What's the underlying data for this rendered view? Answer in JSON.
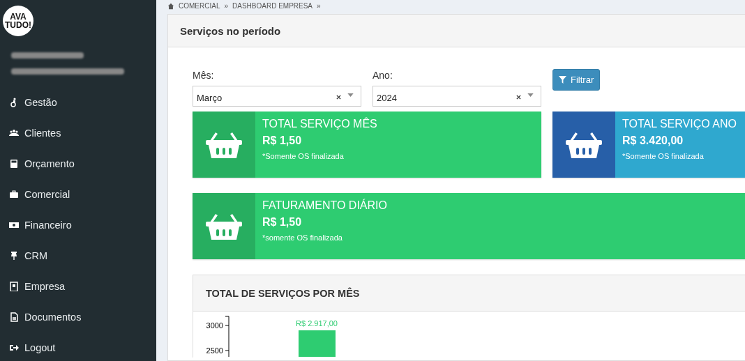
{
  "sidebar": {
    "logo": [
      "AVA",
      "TUDO!"
    ],
    "items": [
      {
        "label": "Gestão"
      },
      {
        "label": "Clientes"
      },
      {
        "label": "Orçamento"
      },
      {
        "label": "Comercial"
      },
      {
        "label": "Financeiro"
      },
      {
        "label": "CRM"
      },
      {
        "label": "Empresa"
      },
      {
        "label": "Documentos"
      },
      {
        "label": "Logout"
      }
    ]
  },
  "breadcrumb": [
    "COMERCIAL",
    "»",
    "DASHBOARD EMPRESA",
    "»"
  ],
  "panel": {
    "title": "Serviços no período",
    "filters": [
      {
        "label": "Mês:",
        "value": "Março"
      },
      {
        "label": "Ano:",
        "value": "2024"
      }
    ],
    "filter_button": "Filtrar",
    "cards": [
      {
        "title": "TOTAL SERVIÇO MÊS",
        "value": "R$ 1,50",
        "note": "*Somente OS finalizada",
        "color": "#2ecc71",
        "icon_area": {
          "color": "#27ae60"
        }
      },
      {
        "title": "TOTAL SERVIÇO ANO",
        "value": "R$ 3.420,00",
        "note": "*Somente OS finalizada",
        "color": "#2fa8cf",
        "icon_area": {
          "color": "#275fa8"
        }
      },
      {
        "title": "FATURAMENTO DIÁRIO",
        "value": "R$ 1,50",
        "note": "*somente OS finalizada",
        "color": "#2ecc71",
        "icon_area": {
          "color": "#27ae60"
        }
      }
    ],
    "chart": {
      "title": "TOTAL DE SERVIÇOS POR MÊS",
      "y_axis_labels": [
        "3000",
        "2500"
      ],
      "bar_label": "R$ 2.917,00"
    }
  }
}
